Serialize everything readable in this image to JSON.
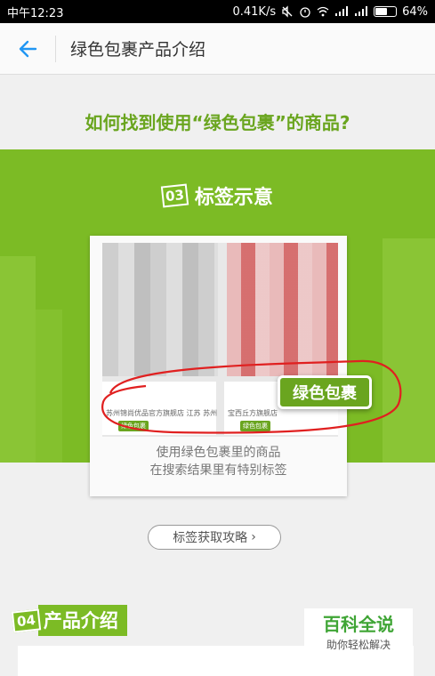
{
  "status_bar": {
    "time": "中午12:23",
    "speed": "0.41K/s",
    "battery_percent": "64%",
    "battery_level": 0.64
  },
  "header": {
    "title": "绿色包裹产品介绍"
  },
  "hero": {
    "question": "如何找到使用“绿色包裹”的商品?"
  },
  "section3": {
    "number": "03",
    "title": "标签示意",
    "tag_label": "绿色包裹",
    "shop_left": "苏州锦尚优品官方旗舰店 江苏 苏州",
    "shop_right": "宝西丘方旗舰店",
    "mini_tag": "绿色包裹",
    "caption_line1": "使用绿色包裹里的商品",
    "caption_line2": "在搜索结果里有特别标签",
    "strategy_button": "标签获取攻略",
    "strategy_arrow": "›"
  },
  "section4": {
    "number": "04",
    "title": "产品介绍"
  },
  "watermark": {
    "title": "百科全说",
    "subtitle": "助你轻松解决"
  },
  "colors": {
    "brand_green": "#7cbb25",
    "text_green": "#6aa51f",
    "accent_blue": "#2196f3",
    "annotation_red": "#e02020"
  }
}
